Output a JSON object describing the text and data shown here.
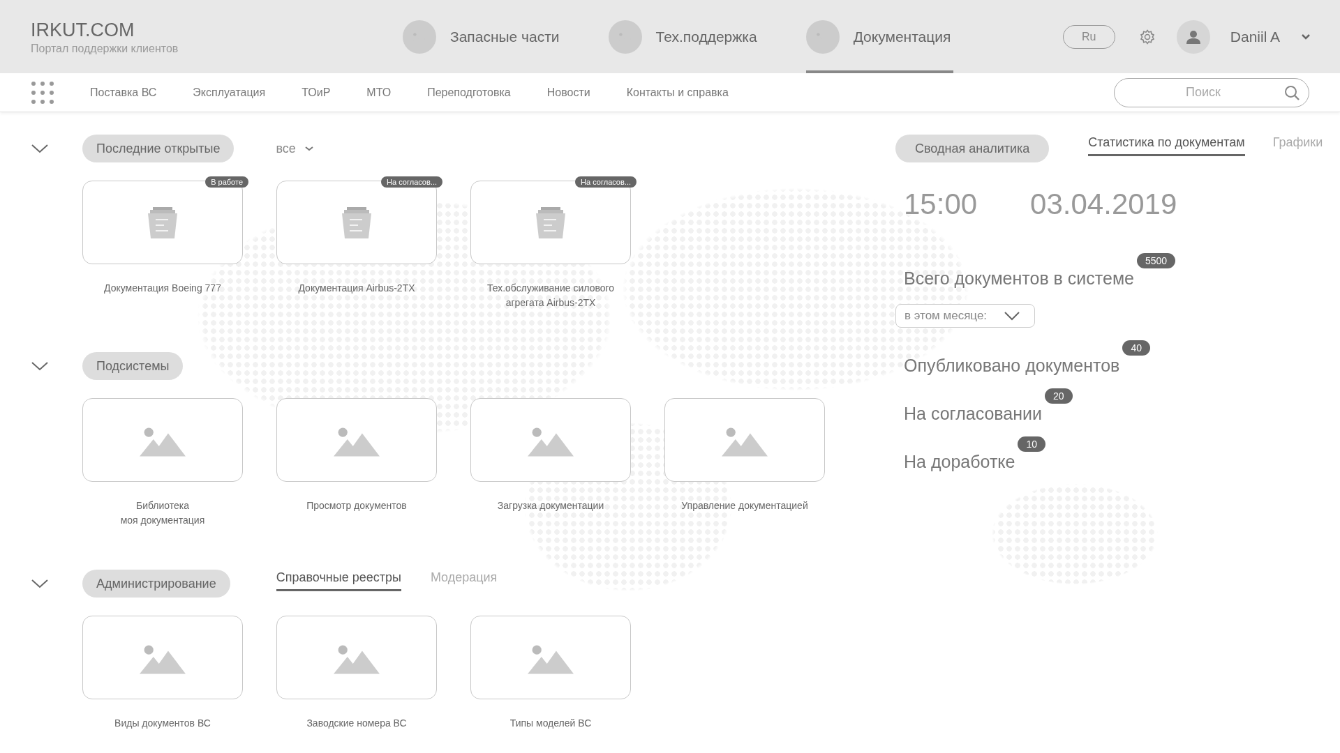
{
  "header": {
    "logo": "IRKUT.COM",
    "subtitle": "Портал поддержки клиентов",
    "nav": [
      {
        "label": "Запасные части",
        "selected": false
      },
      {
        "label": "Тех.поддержка",
        "selected": false
      },
      {
        "label": "Документация",
        "selected": true
      }
    ],
    "language": "Ru",
    "user": "Daniil A"
  },
  "menu": {
    "items": [
      "Поставка ВС",
      "Эксплуатация",
      "ТОиР",
      "МТО",
      "Переподготовка",
      "Новости",
      "Контакты и справка"
    ],
    "search": {
      "placeholder": "Поиск"
    }
  },
  "sections": [
    {
      "title": "Последние открытые",
      "expanded": true,
      "filter": "все",
      "cards": [
        {
          "kind": "document",
          "label": "Документация Boeing 777",
          "status": "В работе"
        },
        {
          "kind": "document",
          "label": "Документация Airbus-2TX",
          "status": "На согласов..."
        },
        {
          "kind": "document",
          "label": "Тех.обслуживание силового агрегата Airbus-2TX",
          "status": "На согласов..."
        }
      ]
    },
    {
      "title": "Подсистемы",
      "expanded": true,
      "cards": [
        {
          "kind": "image",
          "label": "Библиотека\nмоя документация"
        },
        {
          "kind": "image",
          "label": "Просмотр документов"
        },
        {
          "kind": "image",
          "label": "Загрузка документации"
        },
        {
          "kind": "image",
          "label": "Управление документацией"
        }
      ]
    },
    {
      "title": "Администрирование",
      "expanded": true,
      "tabs": [
        {
          "label": "Справочные реестры",
          "selected": true
        },
        {
          "label": "Модерация",
          "selected": false
        }
      ],
      "cards": [
        {
          "kind": "image",
          "label": "Виды документов ВС"
        },
        {
          "kind": "image",
          "label": "Заводские номера ВС"
        },
        {
          "kind": "image",
          "label": "Типы моделей ВС"
        }
      ]
    }
  ],
  "stats": {
    "title": "Сводная аналитика",
    "tabs": [
      {
        "label": "Статистика по документам",
        "selected": true
      },
      {
        "label": "Графики",
        "selected": false
      }
    ],
    "time": "15:00",
    "date": "03.04.2019",
    "total": {
      "label": "Всего документов в системе",
      "count": "5500"
    },
    "period": "в этом месяце:",
    "counts": [
      {
        "label": "Опубликовано документов",
        "count": "40"
      },
      {
        "label": "На согласовании",
        "count": "20"
      },
      {
        "label": "На доработке",
        "count": "10"
      }
    ]
  }
}
